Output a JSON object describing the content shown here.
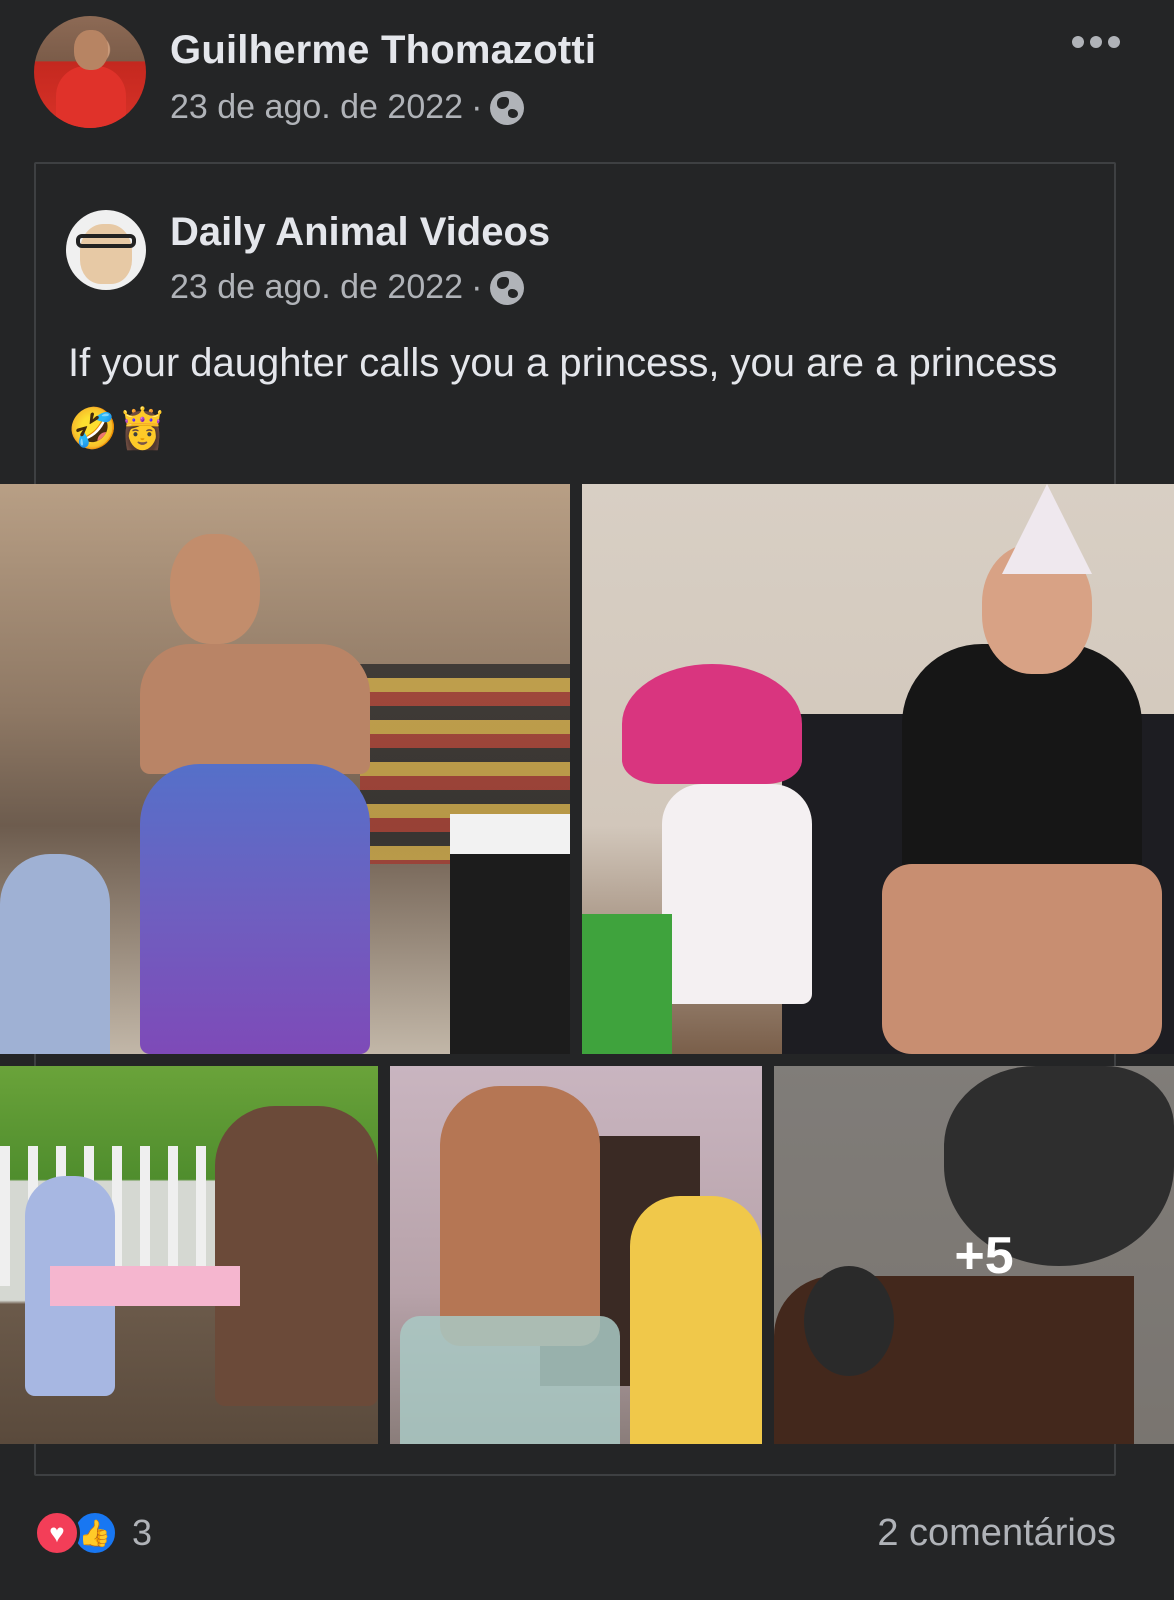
{
  "post": {
    "author": "Guilherme Thomazotti",
    "date": "23 de ago. de 2022",
    "separator": "·",
    "privacy_icon": "globe-icon",
    "more_icon": "more-options-icon"
  },
  "shared": {
    "page_name": "Daily Animal Videos",
    "date": "23 de ago. de 2022",
    "separator": "·",
    "text": "If your daughter calls you a princess, you are a princess",
    "emojis": "🤣👸",
    "more_photos": "+5"
  },
  "footer": {
    "reaction_icons": [
      "love-icon",
      "like-icon"
    ],
    "reaction_count": "3",
    "comments": "2 comentários"
  },
  "colors": {
    "background": "#242526",
    "text_primary": "#e4e6eb",
    "text_secondary": "#b0b3b8",
    "like": "#1877f2",
    "love": "#f33e58"
  }
}
